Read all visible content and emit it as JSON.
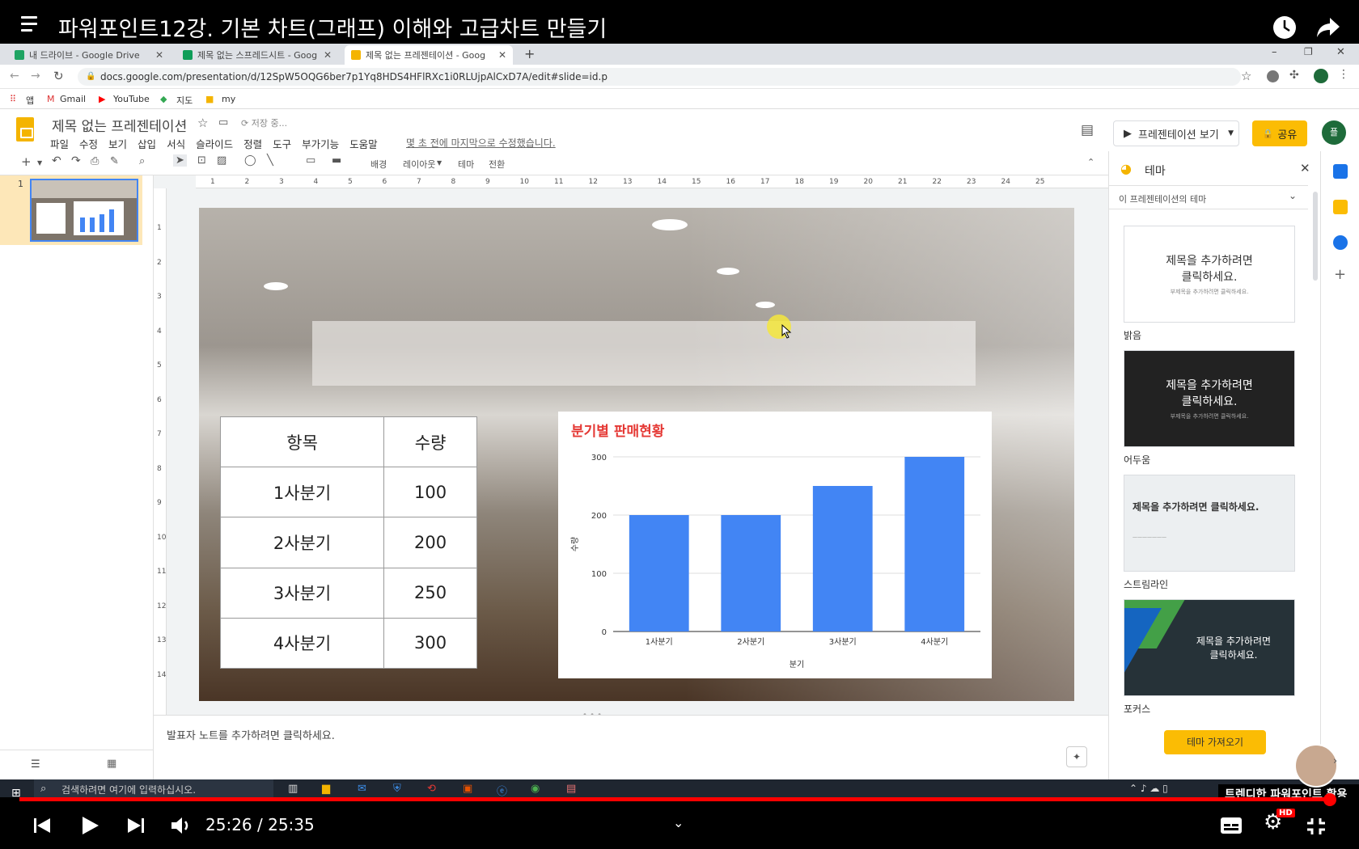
{
  "youtube": {
    "title": "파워포인트12강. 기본 차트(그래프) 이해와 고급차트 만들기",
    "time": "25:26 / 25:35",
    "channel": "트렌디한 파워포인트 활용"
  },
  "tabs": [
    {
      "label": "내 드라이브 - Google Drive",
      "color": "#1fa463"
    },
    {
      "label": "제목 없는 스프레드시트 - Goog",
      "color": "#0f9d58"
    },
    {
      "label": "제목 없는 프레젠테이션 - Goog",
      "color": "#f4b400"
    }
  ],
  "address": {
    "url": "docs.google.com/presentation/d/12SpW5OQG6ber7p1Yq8HDS4HFlRXc1i0RLUjpAlCxD7A/edit#slide=id.p"
  },
  "bookmarks": [
    "앱",
    "Gmail",
    "YouTube",
    "지도",
    "my"
  ],
  "doc": {
    "title": "제목 없는 프레젠테이션",
    "saving": "저장 중...",
    "menus": [
      "파일",
      "수정",
      "보기",
      "삽입",
      "서식",
      "슬라이드",
      "정렬",
      "도구",
      "부가기능",
      "도움말"
    ],
    "last_edit": "몇 초 전에 마지막으로 수정했습니다.",
    "present": "프레젠테이션 보기",
    "share": "공유",
    "avatar": "플"
  },
  "toolbar": {
    "background": "배경",
    "layout": "레이아웃",
    "theme": "테마",
    "transition": "전환"
  },
  "filmstrip": {
    "slide_number": "1"
  },
  "ruler": {
    "h": [
      "1",
      "2",
      "3",
      "4",
      "5",
      "6",
      "7",
      "8",
      "9",
      "10",
      "11",
      "12",
      "13",
      "14",
      "15",
      "16",
      "17",
      "18",
      "19",
      "20",
      "21",
      "22",
      "23",
      "24",
      "25"
    ],
    "v": [
      "1",
      "2",
      "3",
      "4",
      "5",
      "6",
      "7",
      "8",
      "9",
      "10",
      "11",
      "12",
      "13",
      "14"
    ]
  },
  "slide_table": {
    "headers": [
      "항목",
      "수량"
    ],
    "rows": [
      [
        "1사분기",
        "100"
      ],
      [
        "2사분기",
        "200"
      ],
      [
        "3사분기",
        "250"
      ],
      [
        "4사분기",
        "300"
      ]
    ]
  },
  "chart_data": {
    "type": "bar",
    "title": "분기별 판매현황",
    "categories": [
      "1사분기",
      "2사분기",
      "3사분기",
      "4사분기"
    ],
    "values": [
      200,
      200,
      250,
      300
    ],
    "xlabel": "분기",
    "ylabel": "수량",
    "ylim": [
      0,
      300
    ],
    "yticks": [
      0,
      100,
      200,
      300
    ],
    "color": "#4285f4",
    "title_color": "#e53935",
    "grid": true
  },
  "notes": {
    "placeholder": "발표자 노트를 추가하려면 클릭하세요."
  },
  "theme_panel": {
    "title": "테마",
    "section": "이 프레젠테이션의 테마",
    "import": "테마 가져오기",
    "themes": [
      {
        "name": "밝음",
        "line1": "제목을 추가하려면",
        "line2": "클릭하세요.",
        "sub": "부제목을 추가하려면 클릭하세요."
      },
      {
        "name": "어두움",
        "line1": "제목을 추가하려면",
        "line2": "클릭하세요.",
        "sub": "부제목을 추가하려면 클릭하세요."
      },
      {
        "name": "스트림라인",
        "line1": "제목을 추가하려면 클릭하세요.",
        "line2": "",
        "sub": ""
      },
      {
        "name": "포커스",
        "line1": "제목을 추가하려면",
        "line2": "클릭하세요.",
        "sub": ""
      }
    ]
  },
  "taskbar": {
    "search": "검색하려면 여기에 입력하십시오."
  }
}
